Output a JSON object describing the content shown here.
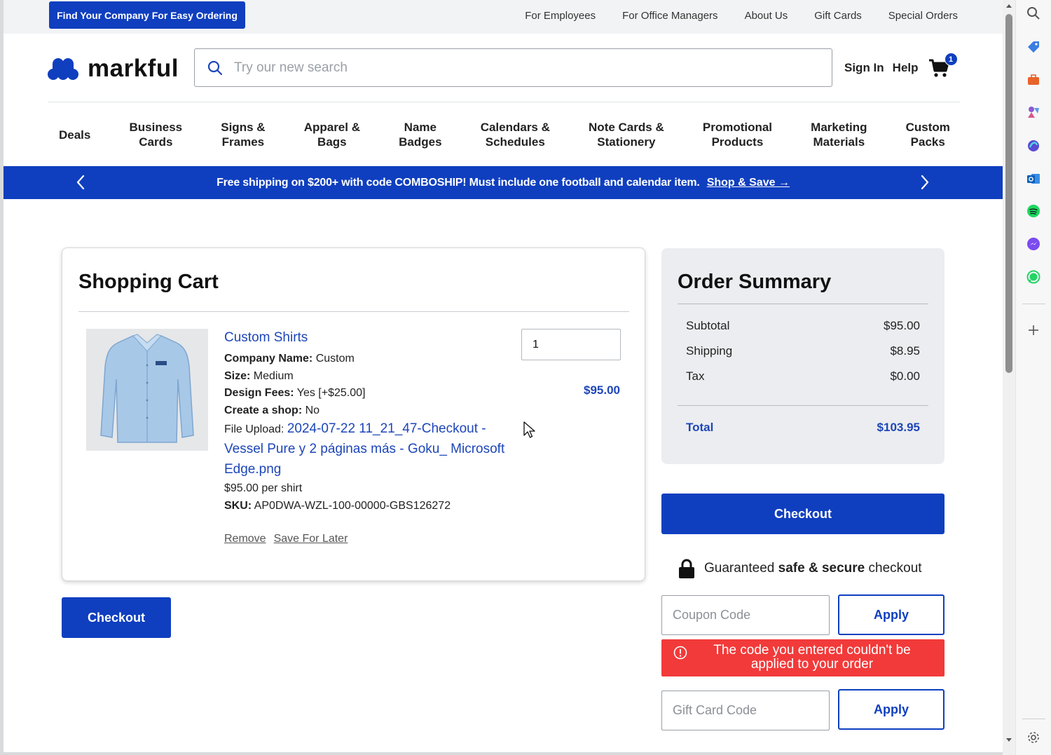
{
  "topbar": {
    "find_company": "Find Your Company For Easy Ordering",
    "links": [
      "For Employees",
      "For Office Managers",
      "About Us",
      "Gift Cards",
      "Special Orders"
    ]
  },
  "header": {
    "logo_text": "markful",
    "search_placeholder": "Try our new search",
    "sign_in": "Sign In",
    "help": "Help",
    "cart_count": "1"
  },
  "categories": [
    "Deals",
    "Business\nCards",
    "Signs &\nFrames",
    "Apparel &\nBags",
    "Name\nBadges",
    "Calendars &\nSchedules",
    "Note Cards &\nStationery",
    "Promotional\nProducts",
    "Marketing\nMaterials",
    "Custom\nPacks"
  ],
  "promo": {
    "text": "Free shipping on $200+ with code COMBOSHIP! Must include one football and calendar item.",
    "link": "Shop & Save →"
  },
  "cart": {
    "title": "Shopping Cart",
    "item": {
      "name": "Custom Shirts",
      "company_label": "Company Name:",
      "company_value": "Custom",
      "size_label": "Size:",
      "size_value": "Medium",
      "fees_label": "Design Fees:",
      "fees_value": "Yes [+$25.00]",
      "shop_label": "Create a shop:",
      "shop_value": "No",
      "file_label": "File Upload:",
      "file_value": "2024-07-22 11_21_47-Checkout - Vessel Pure y 2 páginas más - Goku_ Microsoft Edge.png",
      "unit_price": "$95.00 per shirt",
      "sku_label": "SKU:",
      "sku_value": "AP0DWA-WZL-100-00000-GBS126272",
      "quantity": "1",
      "line_price": "$95.00",
      "remove": "Remove",
      "save_later": "Save For Later"
    },
    "checkout": "Checkout"
  },
  "summary": {
    "title": "Order Summary",
    "rows": [
      {
        "label": "Subtotal",
        "value": "$95.00"
      },
      {
        "label": "Shipping",
        "value": "$8.95"
      },
      {
        "label": "Tax",
        "value": "$0.00"
      }
    ],
    "total_label": "Total",
    "total_value": "$103.95",
    "checkout": "Checkout",
    "secure_prefix": "Guaranteed",
    "secure_bold": "safe & secure",
    "secure_suffix": "checkout",
    "coupon_placeholder": "Coupon Code",
    "apply": "Apply",
    "error": "The code you entered couldn't be applied to your order",
    "gift_placeholder": "Gift Card Code",
    "gift_apply": "Apply"
  },
  "colors": {
    "brand": "#0f3fbf",
    "link": "#1d46b8",
    "error": "#f23a3a"
  },
  "icons": [
    "search-icon",
    "cart-icon",
    "chevron-left-icon",
    "chevron-right-icon",
    "lock-icon",
    "alert-circle-icon",
    "mouse-cursor-icon"
  ]
}
